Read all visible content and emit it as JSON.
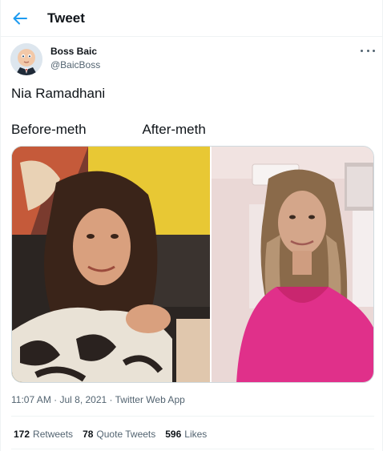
{
  "header": {
    "title": "Tweet",
    "back_icon": "arrow-left-icon",
    "accent": "#1d9bf0"
  },
  "author": {
    "name": "Boss Baic",
    "handle": "@BaicBoss"
  },
  "tweet": {
    "line1": "Nia Ramadhani",
    "line2": "Before-meth               After-meth",
    "timestamp": "11:07 AM · Jul 8, 2021 · Twitter Web App"
  },
  "stats": {
    "retweets_count": "172",
    "retweets_label": "Retweets",
    "quotes_count": "78",
    "quotes_label": "Quote Tweets",
    "likes_count": "596",
    "likes_label": "Likes"
  }
}
